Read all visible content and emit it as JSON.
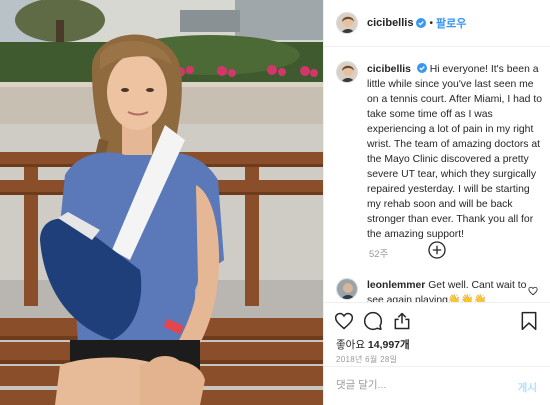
{
  "post": {
    "username": "cicibellis",
    "dot": "•",
    "follow_label": "팔로우"
  },
  "caption": {
    "username": "cicibellis",
    "text": "Hi everyone! It's been a little while since you've last seen me on a tennis court. After Miami, I had to take some time off as I was experiencing a lot of pain in my right wrist. The team of amazing doctors at the Mayo Clinic discovered a pretty severe UT tear, which they surgically repaired yesterday. I will be starting my rehab soon and will be back stronger than ever. Thank you all for the amazing support!",
    "time": "52주"
  },
  "comment": {
    "username": "leonlemmer",
    "text": "Get well. Cant wait to see again playing👋👋👋"
  },
  "likes": {
    "prefix": "좋아요",
    "count": "14,997개"
  },
  "date": "2018년 6월 28일",
  "add_comment": {
    "placeholder": "댓글 달기...",
    "post_label": "게시"
  },
  "icons": {
    "verified": "verified-badge-icon",
    "load_more": "plus-circle-icon",
    "like": "heart-icon",
    "comment": "comment-bubble-icon",
    "share": "share-icon",
    "save": "bookmark-icon"
  },
  "colors": {
    "accent": "#3897f0",
    "post_disabled": "#b2dffc",
    "muted": "#999999",
    "text": "#262626",
    "border": "#efefef"
  }
}
